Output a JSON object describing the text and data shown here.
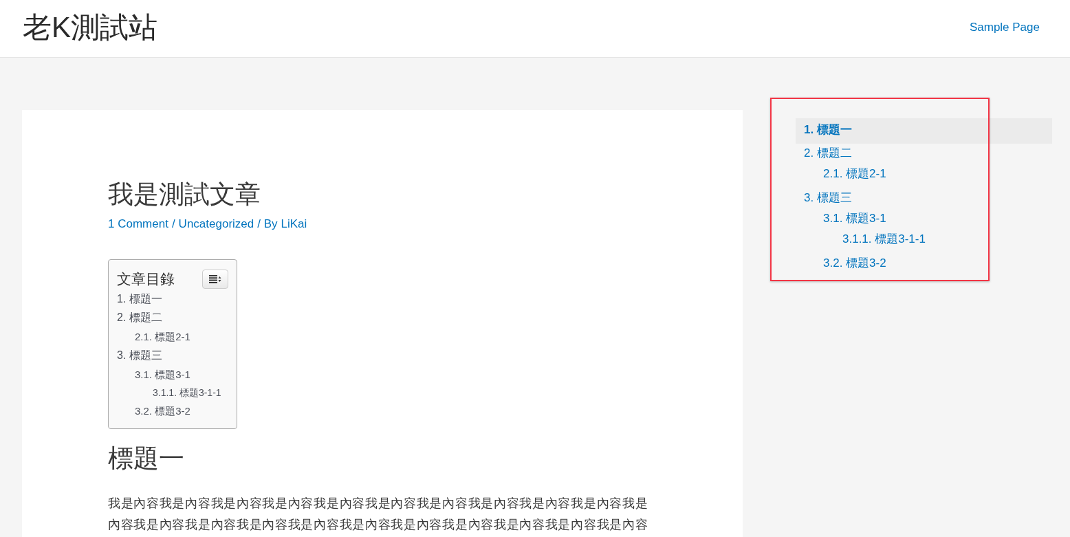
{
  "site": {
    "title": "老K測試站",
    "nav": [
      {
        "label": "Sample Page"
      }
    ]
  },
  "post": {
    "title": "我是測試文章",
    "meta": [
      {
        "link": "1 Comment"
      },
      {
        "prefix": "/",
        "link": "Uncategorized"
      },
      {
        "prefix": "/ By",
        "link": "LiKai"
      }
    ],
    "toc": {
      "title": "文章目錄",
      "items": [
        {
          "label": "1. 標題一"
        },
        {
          "label": "2. 標題二",
          "children": [
            {
              "label": "2.1. 標題2-1"
            }
          ]
        },
        {
          "label": "3. 標題三",
          "children": [
            {
              "label": "3.1. 標題3-1",
              "children": [
                {
                  "label": "3.1.1. 標題3-1-1"
                }
              ]
            },
            {
              "label": "3.2. 標題3-2"
            }
          ]
        }
      ]
    },
    "sections": [
      {
        "heading": "標題一",
        "paragraph": "我是內容我是內容我是內容我是內容我是內容我是內容我是內容我是內容我是內容我是內容我是內容我是內容我是內容我是內容我是內容我是內容我是內容我是內容我是內容我是內容我是內容"
      }
    ]
  },
  "sidebar": {
    "toc": [
      {
        "label": "1. 標題一",
        "selected": true
      },
      {
        "label": "2. 標題二",
        "selected": false,
        "children": [
          {
            "label": "2.1. 標題2-1",
            "selected": false
          }
        ]
      },
      {
        "label": "3. 標題三",
        "selected": false,
        "children": [
          {
            "label": "3.1. 標題3-1",
            "selected": false,
            "children": [
              {
                "label": "3.1.1. 標題3-1-1",
                "selected": false
              }
            ]
          },
          {
            "label": "3.2. 標題3-2",
            "selected": false
          }
        ]
      }
    ]
  }
}
